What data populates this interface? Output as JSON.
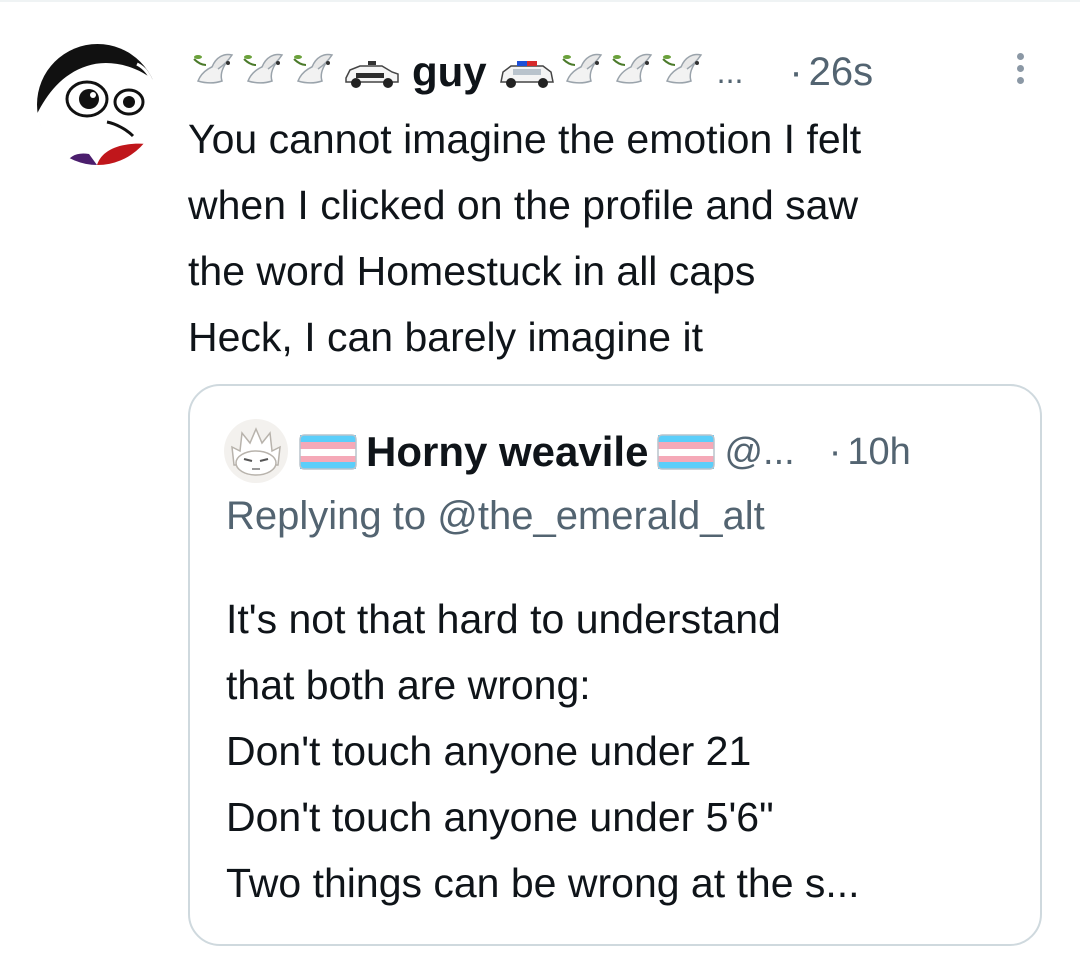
{
  "tweet": {
    "avatar_icon": "cartoon-avatar-icon",
    "name_prefix_emojis": [
      "dove-olive-branch-icon",
      "dove-olive-branch-icon",
      "dove-olive-branch-icon",
      "police-car-icon"
    ],
    "display_name": "guy",
    "name_suffix_emojis": [
      "police-car-icon",
      "dove-olive-branch-icon",
      "dove-olive-branch-icon",
      "dove-olive-branch-icon"
    ],
    "name_truncation": "...",
    "time_separator": "·",
    "timestamp": "26s",
    "more_icon": "more-vertical-icon",
    "lines": [
      "You cannot imagine the emotion I felt",
      "when I clicked on the profile and saw",
      "the word Homestuck in all caps",
      "Heck, I can barely imagine it"
    ]
  },
  "quote": {
    "avatar_icon": "weavile-avatar-icon",
    "flag_icon": "trans-flag-icon",
    "display_name": "Horny weavile",
    "handle": "@...",
    "time_separator": "·",
    "timestamp": "10h",
    "replying_to": "Replying to @the_emerald_alt",
    "lines": [
      "It's not that hard to understand",
      "that both are wrong:",
      "Don't touch anyone under 21",
      "Don't touch anyone under 5'6\"",
      "Two things can be wrong at the s..."
    ]
  },
  "colors": {
    "text_primary": "#0f1419",
    "text_secondary": "#536471",
    "border": "#cfd9de",
    "flag_blue": "#5bcefa",
    "flag_pink": "#f5a9b8"
  }
}
